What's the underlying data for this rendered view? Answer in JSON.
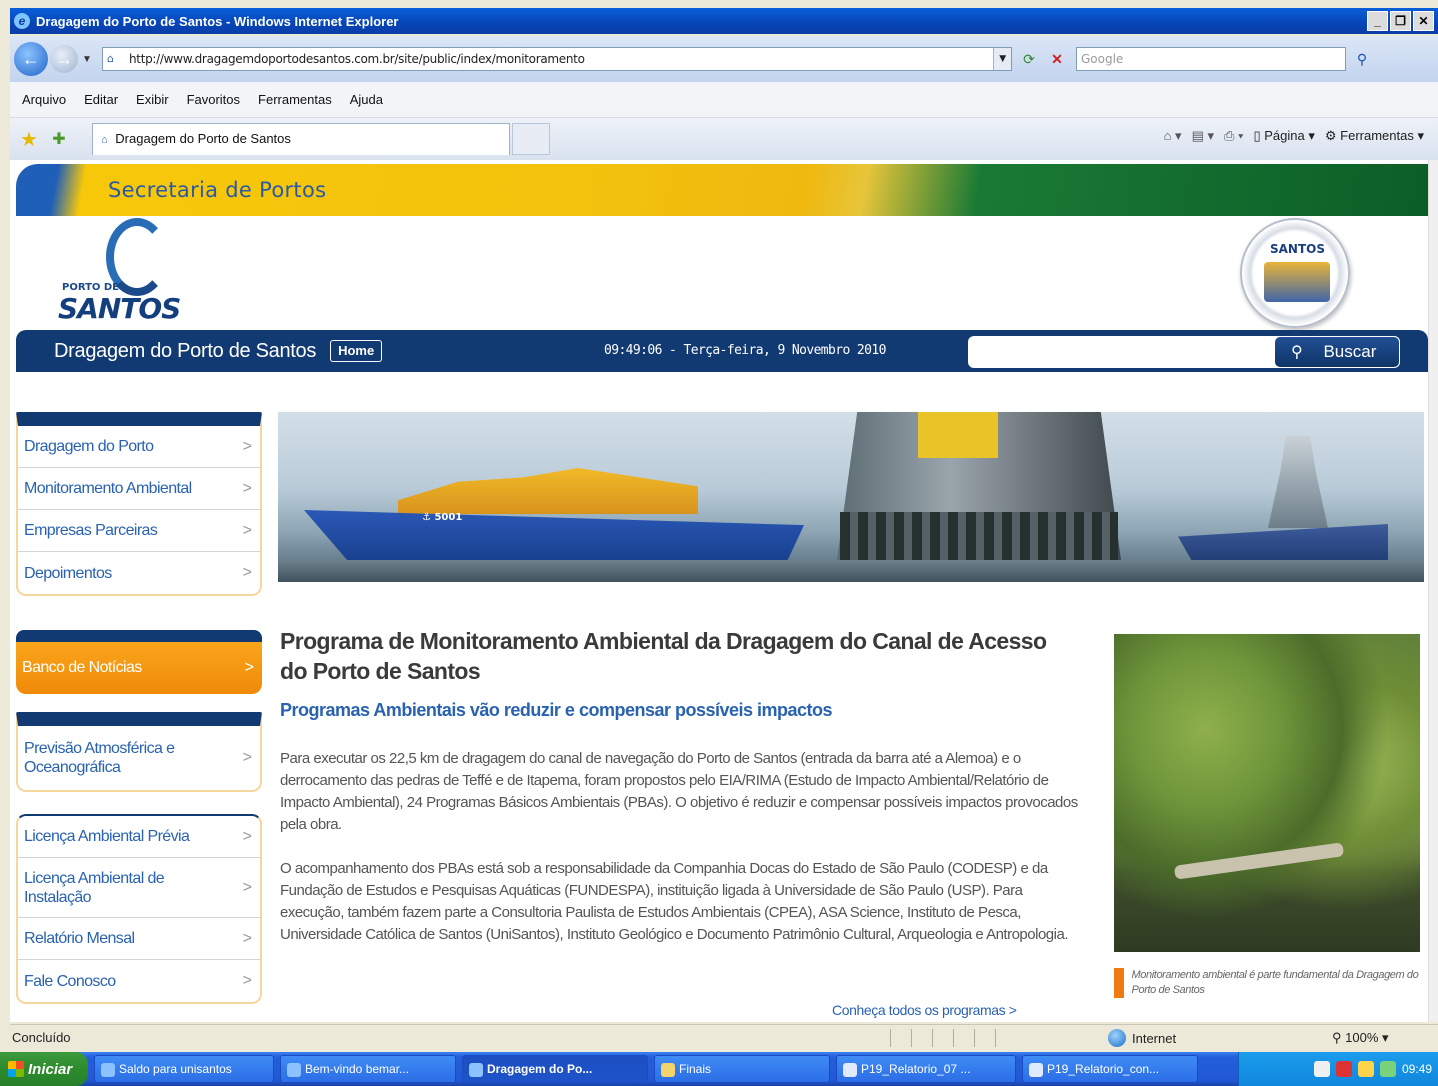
{
  "window": {
    "title": "Dragagem do Porto de Santos - Windows Internet Explorer",
    "controls": [
      "_",
      "\u0000",
      "X"
    ]
  },
  "address": {
    "url": "http://www.dragagemdoportodesantos.com.br/site/public/index/monitoramento",
    "search_placeholder": "Google"
  },
  "menu": [
    "Arquivo",
    "Editar",
    "Exibir",
    "Favoritos",
    "Ferramentas",
    "Ajuda"
  ],
  "tab": {
    "label": "Dragagem do Porto de Santos"
  },
  "commands": {
    "page": "Página",
    "tools": "Ferramentas"
  },
  "site": {
    "secretaria": "Secretaria de Portos",
    "logo_small": "PORTO DE",
    "logo_big": "SANTOS",
    "seal_text": "SANTOS",
    "nav_title": "Dragagem do Porto de Santos",
    "home": "Home",
    "datetime": "09:49:06 - Terça-feira, 9 Novembro 2010",
    "search_button": "Buscar"
  },
  "sidebar": {
    "group1": [
      "Dragagem do Porto",
      "Monitoramento Ambiental",
      "Empresas Parceiras",
      "Depoimentos"
    ],
    "news": "Banco de Notícias",
    "group2": [
      "Previsão Atmosférica e Oceanográfica"
    ],
    "group3": [
      "Licença Ambiental Prévia",
      "Licença Ambiental de Instalação",
      "Relatório Mensal",
      "Fale Conosco"
    ]
  },
  "hero": {
    "ship_name": "⚓ 5001"
  },
  "article": {
    "title": "Programa de Monitoramento Ambiental da Dragagem do Canal de Acesso do Porto de Santos",
    "subtitle": "Programas Ambientais vão reduzir e compensar possíveis impactos",
    "paragraph1": "Para executar os 22,5 km de dragagem do canal de navegação do Porto de Santos (entrada da barra até a Alemoa) e o derrocamento das pedras de Teffé e de Itapema, foram propostos pelo EIA/RIMA (Estudo de Impacto Ambiental/Relatório de Impacto Ambiental), 24 Programas Básicos Ambientais (PBAs). O objetivo é reduzir e compensar possíveis impactos provocados pela obra.",
    "paragraph2": "O acompanhamento dos PBAs está sob a responsabilidade da Companhia Docas do Estado de São Paulo (CODESP) e da Fundação de Estudos e Pesquisas Aquáticas (FUNDESPA), instituição ligada à Universidade de São Paulo (USP). Para execução, também fazem parte a Consultoria Paulista de Estudos Ambientais (CPEA), ASA Science, Instituto de Pesca, Universidade Católica de Santos (UniSantos), Instituto Geológico e Documento Patrimônio Cultural, Arqueologia e Antropologia.",
    "more": "Conheça todos os programas >",
    "caption": "Monitoramento ambiental é parte fundamental da Dragagem do Porto de Santos"
  },
  "status": {
    "text": "Concluído",
    "zone": "Internet",
    "zoom": "100%"
  },
  "taskbar": {
    "start": "Iniciar",
    "tasks": [
      "Saldo para unisantos",
      "Bem-vindo bemar...",
      "Dragagem do Po...",
      "Finais",
      "P19_Relatorio_07 ...",
      "P19_Relatorio_con..."
    ],
    "clock": "09:49"
  }
}
